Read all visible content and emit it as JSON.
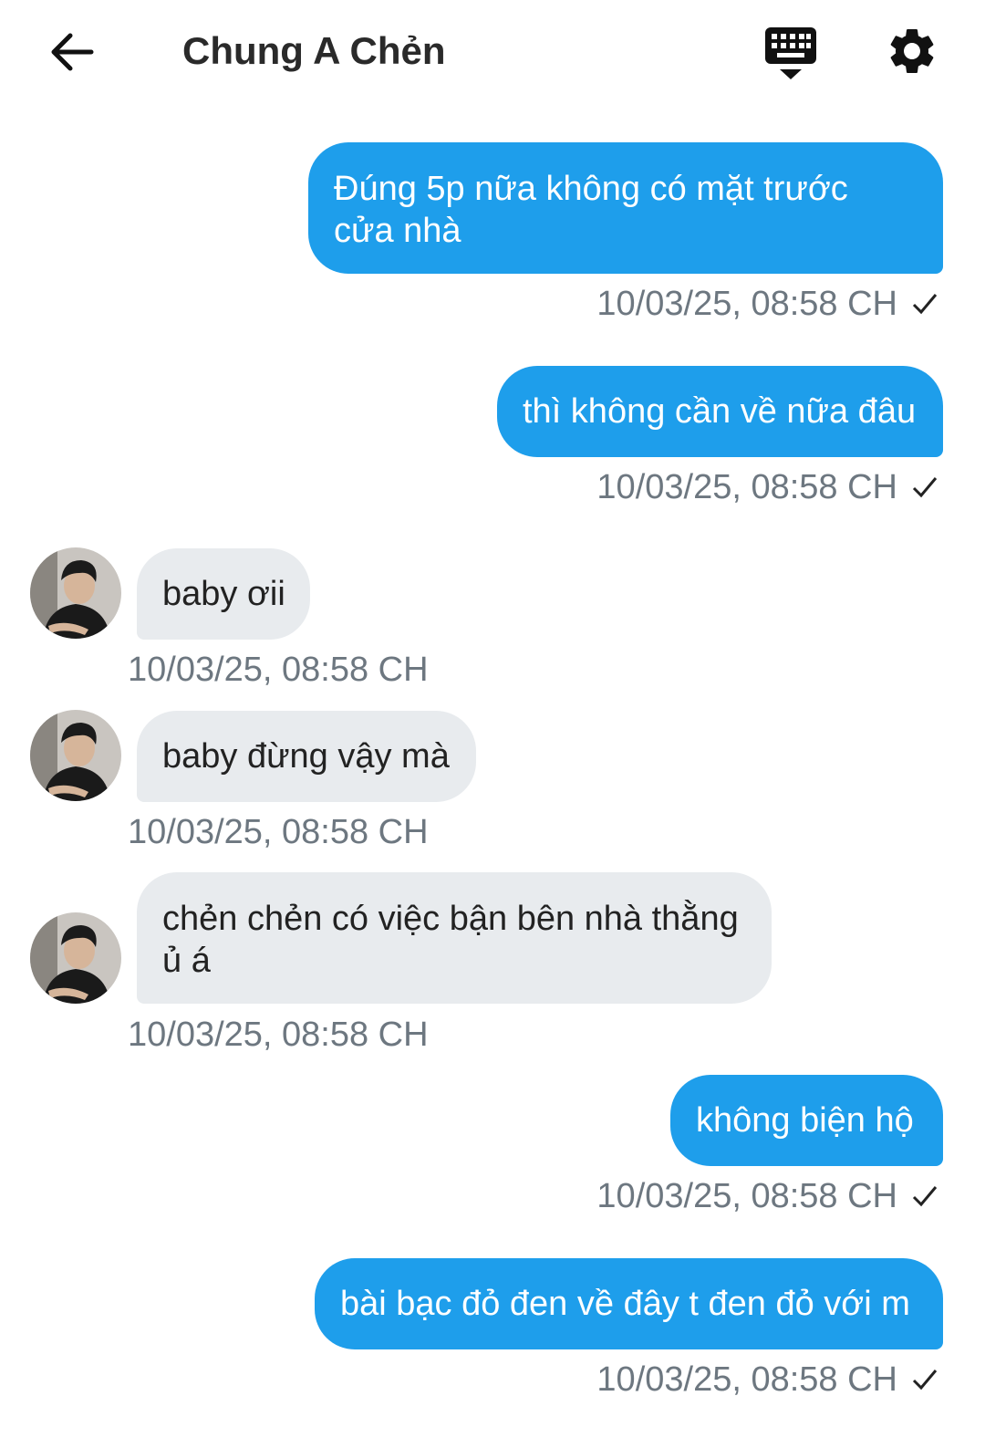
{
  "header": {
    "title": "Chung A Chẻn",
    "back_icon": "arrow-left-icon",
    "keyboard_icon": "keyboard-hide-icon",
    "settings_icon": "gear-icon"
  },
  "colors": {
    "outgoing_bubble": "#1e9eeb",
    "incoming_bubble": "#e8ebee",
    "timestamp": "#6d7780"
  },
  "messages": [
    {
      "direction": "out",
      "text_lines": [
        "Đúng 5p nữa không có mặt trước",
        "cửa nhà"
      ],
      "time": "10/03/25, 08:58 CH",
      "status": "✓"
    },
    {
      "direction": "out",
      "text_lines": [
        "thì không cần về nữa đâu"
      ],
      "time": "10/03/25, 08:58 CH",
      "status": "✓"
    },
    {
      "direction": "in",
      "text_lines": [
        "baby ơii"
      ],
      "time": "10/03/25, 08:58 CH"
    },
    {
      "direction": "in",
      "text_lines": [
        "baby đừng vậy mà"
      ],
      "time": "10/03/25, 08:58 CH"
    },
    {
      "direction": "in",
      "text_lines": [
        "chẻn chẻn có việc bận bên nhà thằng",
        "ủ á"
      ],
      "time": "10/03/25, 08:58 CH"
    },
    {
      "direction": "out",
      "text_lines": [
        "không biện hộ"
      ],
      "time": "10/03/25, 08:58 CH",
      "status": "✓"
    },
    {
      "direction": "out",
      "text_lines": [
        "bài bạc đỏ đen về đây t đen đỏ với m"
      ],
      "time": "10/03/25, 08:58 CH",
      "status": "✓"
    }
  ]
}
